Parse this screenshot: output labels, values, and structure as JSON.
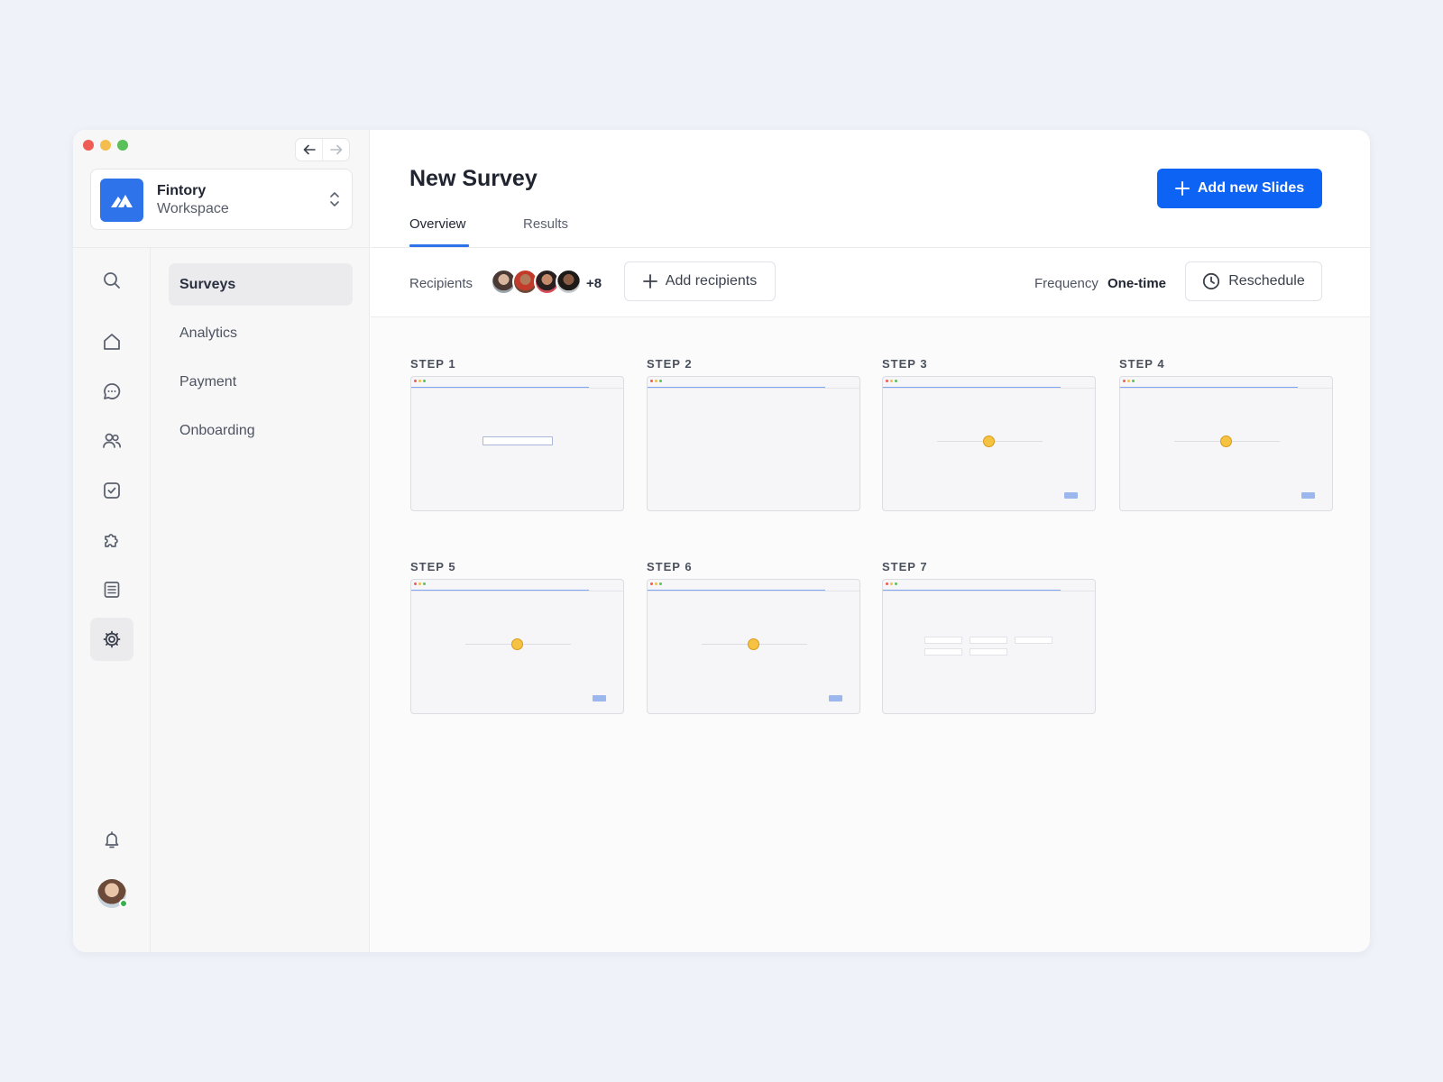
{
  "workspace": {
    "name": "Fintory",
    "subtitle": "Workspace"
  },
  "submenu": [
    "Surveys",
    "Analytics",
    "Payment",
    "Onboarding"
  ],
  "page": {
    "title": "New Survey",
    "add_slides_label": "Add new Slides"
  },
  "tabs": [
    "Overview",
    "Results"
  ],
  "recipients": {
    "label": "Recipients",
    "more_count": "+8",
    "add_label": "Add recipients"
  },
  "frequency": {
    "label": "Frequency",
    "value": "One-time",
    "reschedule_label": "Reschedule"
  },
  "steps": [
    {
      "label": "STEP 1"
    },
    {
      "label": "STEP 2"
    },
    {
      "label": "STEP 3"
    },
    {
      "label": "STEP 4"
    },
    {
      "label": "STEP 5"
    },
    {
      "label": "STEP 6"
    },
    {
      "label": "STEP 7"
    }
  ],
  "colors": {
    "accent": "#0d63f3",
    "online": "#36b24a",
    "traffic_red": "#ee5e56",
    "traffic_yellow": "#f3be4f",
    "traffic_green": "#5ac05a"
  },
  "icons": [
    "search-icon",
    "home-icon",
    "chat-icon",
    "users-icon",
    "checkbox-icon",
    "puzzle-icon",
    "list-icon",
    "gear-icon",
    "bell-icon"
  ]
}
